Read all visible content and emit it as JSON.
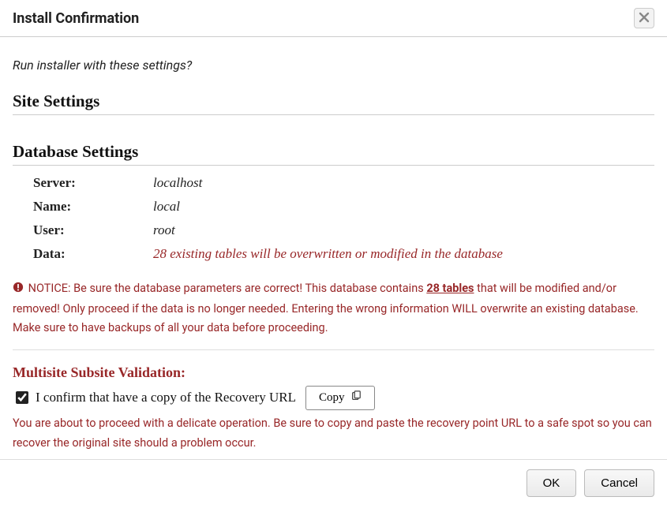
{
  "dialog": {
    "title": "Install Confirmation",
    "prompt": "Run installer with these settings?",
    "close_label": "Close"
  },
  "sections": {
    "site": {
      "heading": "Site Settings"
    },
    "database": {
      "heading": "Database Settings",
      "rows": {
        "server_label": "Server:",
        "server_value": "localhost",
        "name_label": "Name:",
        "name_value": "local",
        "user_label": "User:",
        "user_value": "root",
        "data_label": "Data:",
        "data_value": "28 existing tables will be overwritten or modified in the database"
      }
    }
  },
  "notice": {
    "icon_name": "exclamation-circle-icon",
    "prefix": "NOTICE: Be sure the database parameters are correct! This database contains ",
    "link_text": "28 tables",
    "suffix": " that will be modified and/or removed! Only proceed if the data is no longer needed. Entering the wrong information WILL overwrite an existing database. Make sure to have backups of all your data before proceeding."
  },
  "multisite": {
    "heading": "Multisite Subsite Validation:",
    "checkbox_checked": true,
    "confirm_text": "I confirm that have a copy of the Recovery URL",
    "copy_label": "Copy",
    "copy_icon_name": "copy-icon",
    "proceed_note": "You are about to proceed with a delicate operation. Be sure to copy and paste the recovery point URL to a safe spot so you can recover the original site should a problem occur."
  },
  "buttons": {
    "ok": "OK",
    "cancel": "Cancel"
  }
}
